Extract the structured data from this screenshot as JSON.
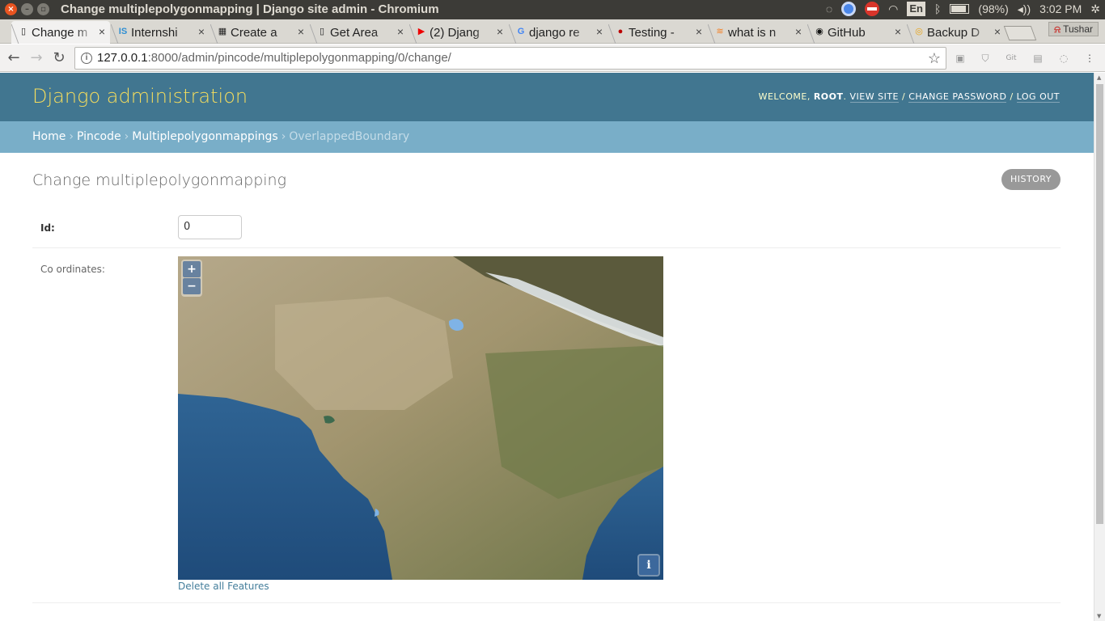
{
  "os": {
    "window_title": "Change multiplepolygonmapping | Django site admin - Chromium",
    "lang": "En",
    "battery": "(98%)",
    "clock": "3:02 PM"
  },
  "browser": {
    "tabs": [
      {
        "label": "Change m",
        "icon": "page-icon"
      },
      {
        "label": "Internshi",
        "icon": "internshala-icon"
      },
      {
        "label": "Create a",
        "icon": "slack-icon"
      },
      {
        "label": "Get Area",
        "icon": "page-icon"
      },
      {
        "label": "(2) Djang",
        "icon": "youtube-icon"
      },
      {
        "label": "django re",
        "icon": "google-icon"
      },
      {
        "label": "Testing -",
        "icon": "testing-icon"
      },
      {
        "label": "what is n",
        "icon": "stackoverflow-icon"
      },
      {
        "label": "GitHub",
        "icon": "github-icon"
      },
      {
        "label": "Backup D",
        "icon": "chrome-icon"
      }
    ],
    "profile": "Tushar",
    "url_host": "127.0.0.1",
    "url_rest": ":8000/admin/pincode/multiplepolygonmapping/0/change/"
  },
  "admin": {
    "branding": "Django administration",
    "welcome": "Welcome,",
    "user": "root",
    "view_site": "View site",
    "change_password": "Change password",
    "log_out": "Log out",
    "breadcrumbs": [
      "Home",
      "Pincode",
      "Multiplepolygonmappings"
    ],
    "breadcrumb_current": "OverlappedBoundary",
    "page_title": "Change multiplepolygonmapping",
    "history_button": "History",
    "fields": {
      "id_label": "Id:",
      "id_value": "0",
      "coords_label": "Co ordinates:"
    },
    "map": {
      "zoom_in": "+",
      "zoom_out": "−",
      "attribution": "i",
      "land_color": "#a89c7c",
      "sea_color": "#2c5a8a"
    },
    "delete_link": "Delete all Features"
  }
}
